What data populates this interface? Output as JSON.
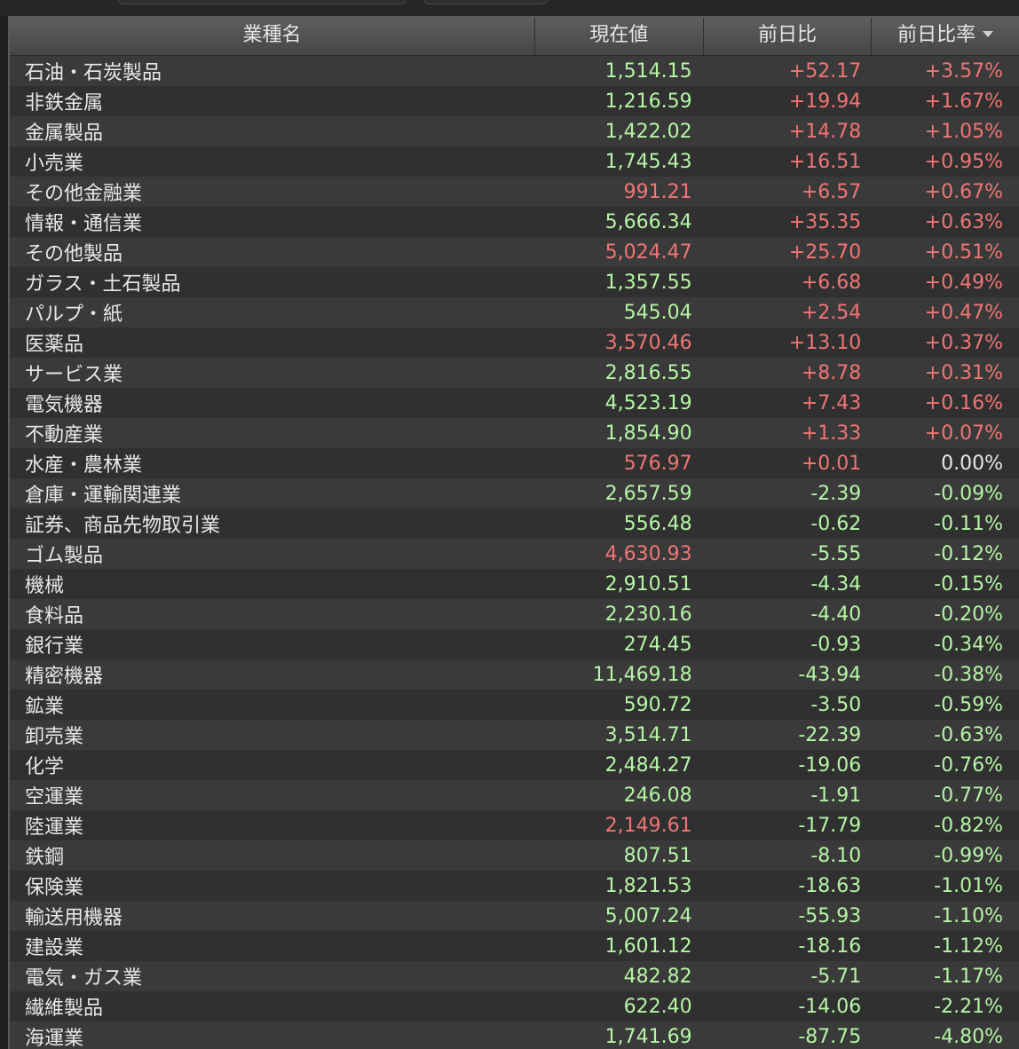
{
  "header": {
    "col_name": "業種名",
    "col_price": "現在値",
    "col_change": "前日比",
    "col_pct": "前日比率"
  },
  "colors": {
    "up": "#f07575",
    "down": "#b5f5a5",
    "neutral": "#e8e8e8"
  },
  "rows": [
    {
      "name": "石油・石炭製品",
      "price": "1,514.15",
      "price_color": "green",
      "change": "+52.17",
      "pct": "+3.57%"
    },
    {
      "name": "非鉄金属",
      "price": "1,216.59",
      "price_color": "green",
      "change": "+19.94",
      "pct": "+1.67%"
    },
    {
      "name": "金属製品",
      "price": "1,422.02",
      "price_color": "green",
      "change": "+14.78",
      "pct": "+1.05%"
    },
    {
      "name": "小売業",
      "price": "1,745.43",
      "price_color": "green",
      "change": "+16.51",
      "pct": "+0.95%"
    },
    {
      "name": "その他金融業",
      "price": "991.21",
      "price_color": "red",
      "change": "+6.57",
      "pct": "+0.67%"
    },
    {
      "name": "情報・通信業",
      "price": "5,666.34",
      "price_color": "green",
      "change": "+35.35",
      "pct": "+0.63%"
    },
    {
      "name": "その他製品",
      "price": "5,024.47",
      "price_color": "red",
      "change": "+25.70",
      "pct": "+0.51%"
    },
    {
      "name": "ガラス・土石製品",
      "price": "1,357.55",
      "price_color": "green",
      "change": "+6.68",
      "pct": "+0.49%"
    },
    {
      "name": "パルプ・紙",
      "price": "545.04",
      "price_color": "green",
      "change": "+2.54",
      "pct": "+0.47%"
    },
    {
      "name": "医薬品",
      "price": "3,570.46",
      "price_color": "red",
      "change": "+13.10",
      "pct": "+0.37%"
    },
    {
      "name": "サービス業",
      "price": "2,816.55",
      "price_color": "green",
      "change": "+8.78",
      "pct": "+0.31%"
    },
    {
      "name": "電気機器",
      "price": "4,523.19",
      "price_color": "green",
      "change": "+7.43",
      "pct": "+0.16%"
    },
    {
      "name": "不動産業",
      "price": "1,854.90",
      "price_color": "green",
      "change": "+1.33",
      "pct": "+0.07%"
    },
    {
      "name": "水産・農林業",
      "price": "576.97",
      "price_color": "red",
      "change": "+0.01",
      "pct": "0.00%"
    },
    {
      "name": "倉庫・運輸関連業",
      "price": "2,657.59",
      "price_color": "green",
      "change": "-2.39",
      "pct": "-0.09%"
    },
    {
      "name": "証券、商品先物取引業",
      "price": "556.48",
      "price_color": "green",
      "change": "-0.62",
      "pct": "-0.11%"
    },
    {
      "name": "ゴム製品",
      "price": "4,630.93",
      "price_color": "red",
      "change": "-5.55",
      "pct": "-0.12%"
    },
    {
      "name": "機械",
      "price": "2,910.51",
      "price_color": "green",
      "change": "-4.34",
      "pct": "-0.15%"
    },
    {
      "name": "食料品",
      "price": "2,230.16",
      "price_color": "green",
      "change": "-4.40",
      "pct": "-0.20%"
    },
    {
      "name": "銀行業",
      "price": "274.45",
      "price_color": "green",
      "change": "-0.93",
      "pct": "-0.34%"
    },
    {
      "name": "精密機器",
      "price": "11,469.18",
      "price_color": "green",
      "change": "-43.94",
      "pct": "-0.38%"
    },
    {
      "name": "鉱業",
      "price": "590.72",
      "price_color": "green",
      "change": "-3.50",
      "pct": "-0.59%"
    },
    {
      "name": "卸売業",
      "price": "3,514.71",
      "price_color": "green",
      "change": "-22.39",
      "pct": "-0.63%"
    },
    {
      "name": "化学",
      "price": "2,484.27",
      "price_color": "green",
      "change": "-19.06",
      "pct": "-0.76%"
    },
    {
      "name": "空運業",
      "price": "246.08",
      "price_color": "green",
      "change": "-1.91",
      "pct": "-0.77%"
    },
    {
      "name": "陸運業",
      "price": "2,149.61",
      "price_color": "red",
      "change": "-17.79",
      "pct": "-0.82%"
    },
    {
      "name": "鉄鋼",
      "price": "807.51",
      "price_color": "green",
      "change": "-8.10",
      "pct": "-0.99%"
    },
    {
      "name": "保険業",
      "price": "1,821.53",
      "price_color": "green",
      "change": "-18.63",
      "pct": "-1.01%"
    },
    {
      "name": "輸送用機器",
      "price": "5,007.24",
      "price_color": "green",
      "change": "-55.93",
      "pct": "-1.10%"
    },
    {
      "name": "建設業",
      "price": "1,601.12",
      "price_color": "green",
      "change": "-18.16",
      "pct": "-1.12%"
    },
    {
      "name": "電気・ガス業",
      "price": "482.82",
      "price_color": "green",
      "change": "-5.71",
      "pct": "-1.17%"
    },
    {
      "name": "繊維製品",
      "price": "622.40",
      "price_color": "green",
      "change": "-14.06",
      "pct": "-2.21%"
    },
    {
      "name": "海運業",
      "price": "1,741.69",
      "price_color": "green",
      "change": "-87.75",
      "pct": "-4.80%"
    }
  ]
}
